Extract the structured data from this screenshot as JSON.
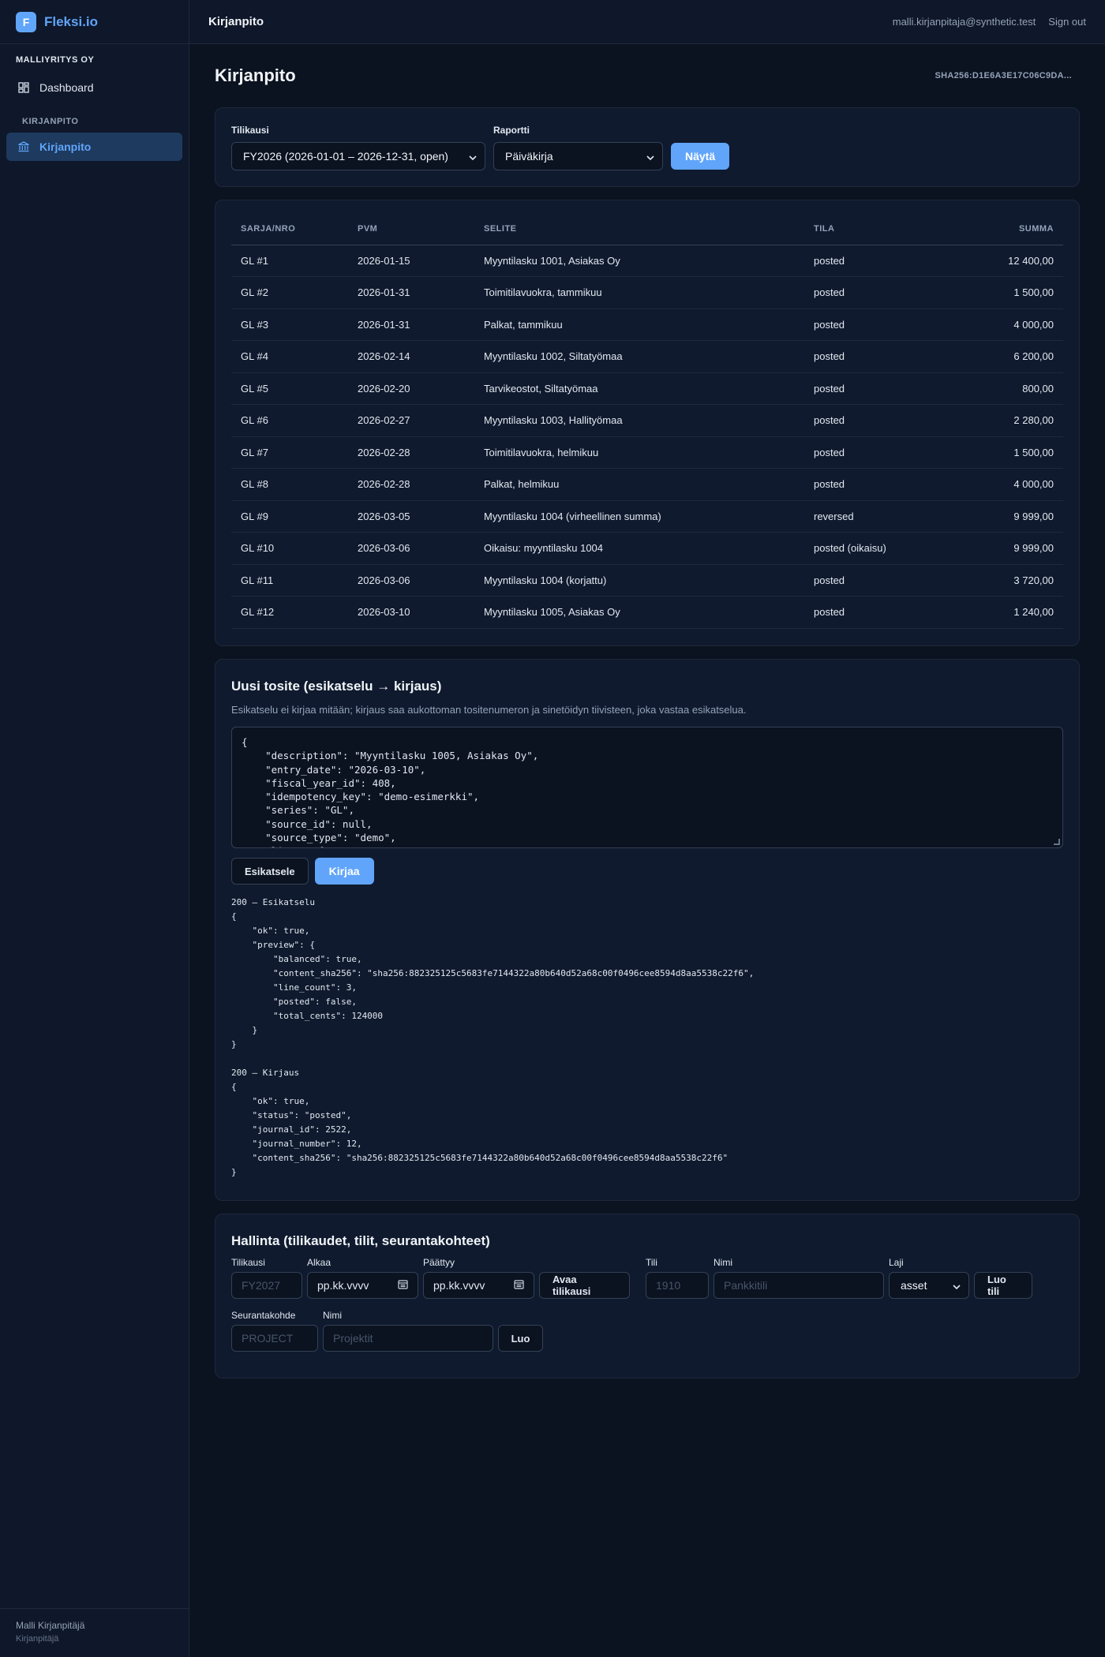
{
  "brand": {
    "logo_letter": "F",
    "name": "Fleksi.io"
  },
  "sidebar": {
    "company": "MALLIYRITYS OY",
    "dashboard_label": "Dashboard",
    "section_label": "KIRJANPITO",
    "active_label": "Kirjanpito",
    "footer_name": "Malli Kirjanpitäjä",
    "footer_role": "Kirjanpitäjä"
  },
  "topbar": {
    "title": "Kirjanpito",
    "email": "malli.kirjanpitaja@synthetic.test",
    "signout": "Sign out"
  },
  "page": {
    "title": "Kirjanpito",
    "hash": "SHA256:D1E6A3E17C06C9DA..."
  },
  "filters": {
    "fiscal_label": "Tilikausi",
    "fiscal_value": "FY2026 (2026-01-01 – 2026-12-31, open)",
    "report_label": "Raportti",
    "report_value": "Päiväkirja",
    "show_button": "Näytä"
  },
  "journal": {
    "headers": [
      "SARJA/NRO",
      "PVM",
      "SELITE",
      "TILA",
      "SUMMA"
    ],
    "rows": [
      [
        "GL #1",
        "2026-01-15",
        "Myyntilasku 1001, Asiakas Oy",
        "posted",
        "12 400,00"
      ],
      [
        "GL #2",
        "2026-01-31",
        "Toimitilavuokra, tammikuu",
        "posted",
        "1 500,00"
      ],
      [
        "GL #3",
        "2026-01-31",
        "Palkat, tammikuu",
        "posted",
        "4 000,00"
      ],
      [
        "GL #4",
        "2026-02-14",
        "Myyntilasku 1002, Siltatyömaa",
        "posted",
        "6 200,00"
      ],
      [
        "GL #5",
        "2026-02-20",
        "Tarvikeostot, Siltatyömaa",
        "posted",
        "800,00"
      ],
      [
        "GL #6",
        "2026-02-27",
        "Myyntilasku 1003, Hallityömaa",
        "posted",
        "2 280,00"
      ],
      [
        "GL #7",
        "2026-02-28",
        "Toimitilavuokra, helmikuu",
        "posted",
        "1 500,00"
      ],
      [
        "GL #8",
        "2026-02-28",
        "Palkat, helmikuu",
        "posted",
        "4 000,00"
      ],
      [
        "GL #9",
        "2026-03-05",
        "Myyntilasku 1004 (virheellinen summa)",
        "reversed",
        "9 999,00"
      ],
      [
        "GL #10",
        "2026-03-06",
        "Oikaisu: myyntilasku 1004",
        "posted (oikaisu)",
        "9 999,00"
      ],
      [
        "GL #11",
        "2026-03-06",
        "Myyntilasku 1004 (korjattu)",
        "posted",
        "3 720,00"
      ],
      [
        "GL #12",
        "2026-03-10",
        "Myyntilasku 1005, Asiakas Oy",
        "posted",
        "1 240,00"
      ]
    ]
  },
  "entry": {
    "title": "Uusi tosite (esikatselu → kirjaus)",
    "subtitle": "Esikatselu ei kirjaa mitään; kirjaus saa aukottoman tositenumeron ja sinetöidyn tiivisteen, joka vastaa esikatselua.",
    "code": "{\n    \"description\": \"Myyntilasku 1005, Asiakas Oy\",\n    \"entry_date\": \"2026-03-10\",\n    \"fiscal_year_id\": 408,\n    \"idempotency_key\": \"demo-esimerkki\",\n    \"series\": \"GL\",\n    \"source_id\": null,\n    \"source_type\": \"demo\",\n    \"lines\": [",
    "preview_button": "Esikatsele",
    "post_button": "Kirjaa",
    "result": "200 — Esikatselu\n{\n    \"ok\": true,\n    \"preview\": {\n        \"balanced\": true,\n        \"content_sha256\": \"sha256:882325125c5683fe7144322a80b640d52a68c00f0496cee8594d8aa5538c22f6\",\n        \"line_count\": 3,\n        \"posted\": false,\n        \"total_cents\": 124000\n    }\n}\n\n200 — Kirjaus\n{\n    \"ok\": true,\n    \"status\": \"posted\",\n    \"journal_id\": 2522,\n    \"journal_number\": 12,\n    \"content_sha256\": \"sha256:882325125c5683fe7144322a80b640d52a68c00f0496cee8594d8aa5538c22f6\"\n}"
  },
  "admin": {
    "title": "Hallinta (tilikaudet, tilit, seurantakohteet)",
    "fiscal_label": "Tilikausi",
    "fiscal_placeholder": "FY2027",
    "start_label": "Alkaa",
    "start_value": "pp.kk.vvvv",
    "end_label": "Päättyy",
    "end_value": "pp.kk.vvvv",
    "open_fiscal_button": "Avaa tilikausi",
    "account_label": "Tili",
    "account_placeholder": "1910",
    "name_label": "Nimi",
    "name_placeholder": "Pankkitili",
    "type_label": "Laji",
    "type_value": "asset",
    "create_account_button": "Luo tili",
    "tracking_label": "Seurantakohde",
    "tracking_placeholder": "PROJECT",
    "tracking_name_label": "Nimi",
    "tracking_name_placeholder": "Projektit",
    "create_button": "Luo"
  },
  "colors": {
    "accent": "#60a5fa",
    "background": "#0b1220",
    "card": "#0f1a2e",
    "border": "#1e293b"
  }
}
